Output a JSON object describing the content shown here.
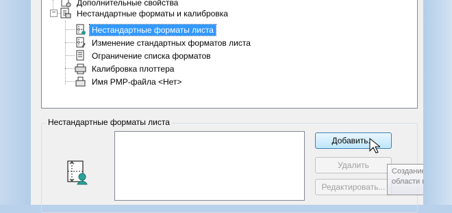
{
  "tree": {
    "items": [
      {
        "label": "Дополнительные свойства",
        "icon": "properties-icon",
        "selected": false
      },
      {
        "label": "Нестандартные форматы и калибровка",
        "icon": "printer-calibration-icon",
        "selected": false
      },
      {
        "label": "Нестандартные форматы листа",
        "icon": "custom-paper-size-icon",
        "selected": true
      },
      {
        "label": "Изменение стандартных форматов листа",
        "icon": "modify-paper-size-icon",
        "selected": false
      },
      {
        "label": "Ограничение списка форматов",
        "icon": "filter-paper-sizes-icon",
        "selected": false
      },
      {
        "label": "Калибровка плоттера",
        "icon": "plotter-calibration-icon",
        "selected": false
      },
      {
        "label": "Имя PMP-файла <Нет>",
        "icon": "pmp-file-icon",
        "selected": false
      }
    ],
    "expander": "−"
  },
  "group": {
    "title": "Нестандартные форматы листа"
  },
  "buttons": {
    "add": "Добавить...",
    "delete": "Удалить",
    "edit": "Редактировать..."
  },
  "tooltip": {
    "line1": "Создание польз",
    "line2": "области печати"
  }
}
